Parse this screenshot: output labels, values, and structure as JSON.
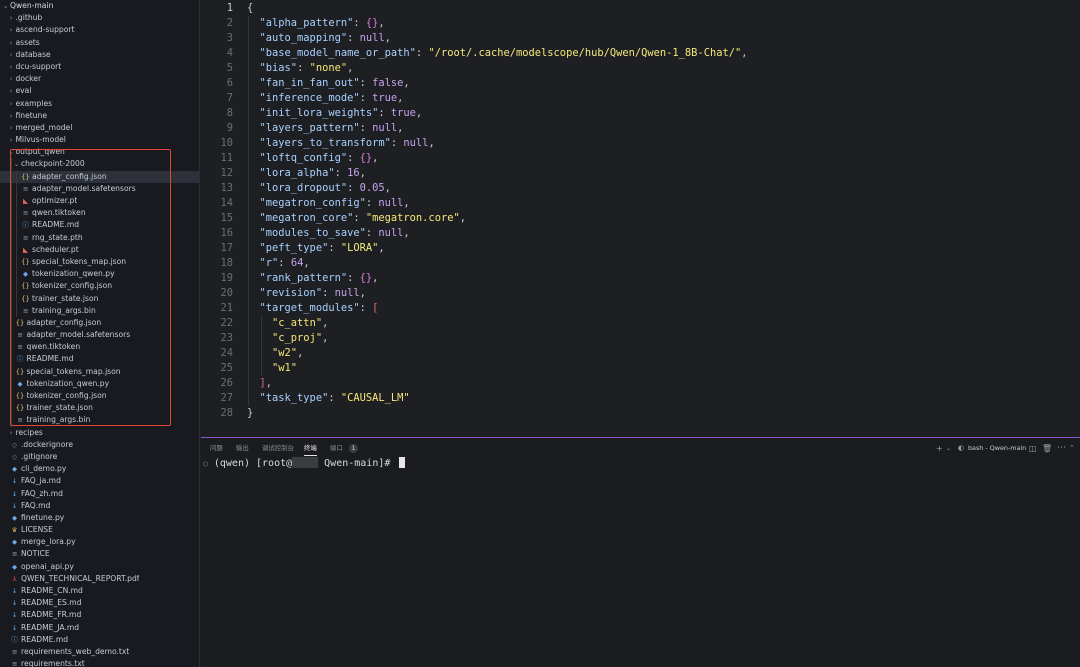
{
  "explorer": {
    "rows": [
      {
        "label": "Qwen-main",
        "depth": 0,
        "kind": "folder-open",
        "icon": "chevron-down-icon"
      },
      {
        "label": ".github",
        "depth": 1,
        "kind": "folder"
      },
      {
        "label": "ascend-support",
        "depth": 1,
        "kind": "folder"
      },
      {
        "label": "assets",
        "depth": 1,
        "kind": "folder"
      },
      {
        "label": "database",
        "depth": 1,
        "kind": "folder"
      },
      {
        "label": "dcu-support",
        "depth": 1,
        "kind": "folder"
      },
      {
        "label": "docker",
        "depth": 1,
        "kind": "folder"
      },
      {
        "label": "eval",
        "depth": 1,
        "kind": "folder"
      },
      {
        "label": "examples",
        "depth": 1,
        "kind": "folder"
      },
      {
        "label": "finetune",
        "depth": 1,
        "kind": "folder"
      },
      {
        "label": "merged_model",
        "depth": 1,
        "kind": "folder"
      },
      {
        "label": "Milvus-model",
        "depth": 1,
        "kind": "folder"
      },
      {
        "label": "output_qwen",
        "depth": 1,
        "kind": "folder-open"
      },
      {
        "label": "checkpoint-2000",
        "depth": 2,
        "kind": "folder-open"
      },
      {
        "label": "adapter_config.json",
        "depth": 3,
        "kind": "json",
        "selected": true
      },
      {
        "label": "adapter_model.safetensors",
        "depth": 3,
        "kind": "txt"
      },
      {
        "label": "optimizer.pt",
        "depth": 3,
        "kind": "pt"
      },
      {
        "label": "qwen.tiktoken",
        "depth": 3,
        "kind": "txt"
      },
      {
        "label": "README.md",
        "depth": 3,
        "kind": "info"
      },
      {
        "label": "rng_state.pth",
        "depth": 3,
        "kind": "txt"
      },
      {
        "label": "scheduler.pt",
        "depth": 3,
        "kind": "pt"
      },
      {
        "label": "special_tokens_map.json",
        "depth": 3,
        "kind": "json"
      },
      {
        "label": "tokenization_qwen.py",
        "depth": 3,
        "kind": "py"
      },
      {
        "label": "tokenizer_config.json",
        "depth": 3,
        "kind": "json"
      },
      {
        "label": "trainer_state.json",
        "depth": 3,
        "kind": "json"
      },
      {
        "label": "training_args.bin",
        "depth": 3,
        "kind": "txt"
      },
      {
        "label": "adapter_config.json",
        "depth": 2,
        "kind": "json"
      },
      {
        "label": "adapter_model.safetensors",
        "depth": 2,
        "kind": "txt"
      },
      {
        "label": "qwen.tiktoken",
        "depth": 2,
        "kind": "txt"
      },
      {
        "label": "README.md",
        "depth": 2,
        "kind": "info"
      },
      {
        "label": "special_tokens_map.json",
        "depth": 2,
        "kind": "json"
      },
      {
        "label": "tokenization_qwen.py",
        "depth": 2,
        "kind": "py"
      },
      {
        "label": "tokenizer_config.json",
        "depth": 2,
        "kind": "json"
      },
      {
        "label": "trainer_state.json",
        "depth": 2,
        "kind": "json"
      },
      {
        "label": "training_args.bin",
        "depth": 2,
        "kind": "txt"
      },
      {
        "label": "recipes",
        "depth": 1,
        "kind": "folder"
      },
      {
        "label": ".dockerignore",
        "depth": 1,
        "kind": "git"
      },
      {
        "label": ".gitignore",
        "depth": 1,
        "kind": "git"
      },
      {
        "label": "cli_demo.py",
        "depth": 1,
        "kind": "py"
      },
      {
        "label": "FAQ_ja.md",
        "depth": 1,
        "kind": "md"
      },
      {
        "label": "FAQ_zh.md",
        "depth": 1,
        "kind": "md"
      },
      {
        "label": "FAQ.md",
        "depth": 1,
        "kind": "md"
      },
      {
        "label": "finetune.py",
        "depth": 1,
        "kind": "py"
      },
      {
        "label": "LICENSE",
        "depth": 1,
        "kind": "lic"
      },
      {
        "label": "merge_lora.py",
        "depth": 1,
        "kind": "py"
      },
      {
        "label": "NOTICE",
        "depth": 1,
        "kind": "txt"
      },
      {
        "label": "openai_api.py",
        "depth": 1,
        "kind": "py"
      },
      {
        "label": "QWEN_TECHNICAL_REPORT.pdf",
        "depth": 1,
        "kind": "pdf"
      },
      {
        "label": "README_CN.md",
        "depth": 1,
        "kind": "md"
      },
      {
        "label": "README_ES.md",
        "depth": 1,
        "kind": "md"
      },
      {
        "label": "README_FR.md",
        "depth": 1,
        "kind": "md"
      },
      {
        "label": "README_JA.md",
        "depth": 1,
        "kind": "md"
      },
      {
        "label": "README.md",
        "depth": 1,
        "kind": "info"
      },
      {
        "label": "requirements_web_demo.txt",
        "depth": 1,
        "kind": "txt"
      },
      {
        "label": "requirements.txt",
        "depth": 1,
        "kind": "txt"
      }
    ]
  },
  "editor": {
    "active_line": 1,
    "lines": [
      [
        [
          "{",
          "p"
        ]
      ],
      [
        [
          "\"alpha_pattern\"",
          "k"
        ],
        [
          ": ",
          "p"
        ],
        [
          "{}",
          "br-m"
        ],
        [
          ",",
          "p"
        ]
      ],
      [
        [
          "\"auto_mapping\"",
          "k"
        ],
        [
          ": ",
          "p"
        ],
        [
          "null",
          "n"
        ],
        [
          ",",
          "p"
        ]
      ],
      [
        [
          "\"base_model_name_or_path\"",
          "k"
        ],
        [
          ": ",
          "p"
        ],
        [
          "\"/root/.cache/modelscope/hub/Qwen/Qwen-1_8B-Chat/\"",
          "s"
        ],
        [
          ",",
          "p"
        ]
      ],
      [
        [
          "\"bias\"",
          "k"
        ],
        [
          ": ",
          "p"
        ],
        [
          "\"none\"",
          "s"
        ],
        [
          ",",
          "p"
        ]
      ],
      [
        [
          "\"fan_in_fan_out\"",
          "k"
        ],
        [
          ": ",
          "p"
        ],
        [
          "false",
          "n"
        ],
        [
          ",",
          "p"
        ]
      ],
      [
        [
          "\"inference_mode\"",
          "k"
        ],
        [
          ": ",
          "p"
        ],
        [
          "true",
          "n"
        ],
        [
          ",",
          "p"
        ]
      ],
      [
        [
          "\"init_lora_weights\"",
          "k"
        ],
        [
          ": ",
          "p"
        ],
        [
          "true",
          "n"
        ],
        [
          ",",
          "p"
        ]
      ],
      [
        [
          "\"layers_pattern\"",
          "k"
        ],
        [
          ": ",
          "p"
        ],
        [
          "null",
          "n"
        ],
        [
          ",",
          "p"
        ]
      ],
      [
        [
          "\"layers_to_transform\"",
          "k"
        ],
        [
          ": ",
          "p"
        ],
        [
          "null",
          "n"
        ],
        [
          ",",
          "p"
        ]
      ],
      [
        [
          "\"loftq_config\"",
          "k"
        ],
        [
          ": ",
          "p"
        ],
        [
          "{}",
          "br-m"
        ],
        [
          ",",
          "p"
        ]
      ],
      [
        [
          "\"lora_alpha\"",
          "k"
        ],
        [
          ": ",
          "p"
        ],
        [
          "16",
          "n"
        ],
        [
          ",",
          "p"
        ]
      ],
      [
        [
          "\"lora_dropout\"",
          "k"
        ],
        [
          ": ",
          "p"
        ],
        [
          "0.05",
          "n"
        ],
        [
          ",",
          "p"
        ]
      ],
      [
        [
          "\"megatron_config\"",
          "k"
        ],
        [
          ": ",
          "p"
        ],
        [
          "null",
          "n"
        ],
        [
          ",",
          "p"
        ]
      ],
      [
        [
          "\"megatron_core\"",
          "k"
        ],
        [
          ": ",
          "p"
        ],
        [
          "\"megatron.core\"",
          "s"
        ],
        [
          ",",
          "p"
        ]
      ],
      [
        [
          "\"modules_to_save\"",
          "k"
        ],
        [
          ": ",
          "p"
        ],
        [
          "null",
          "n"
        ],
        [
          ",",
          "p"
        ]
      ],
      [
        [
          "\"peft_type\"",
          "k"
        ],
        [
          ": ",
          "p"
        ],
        [
          "\"LORA\"",
          "s"
        ],
        [
          ",",
          "p"
        ]
      ],
      [
        [
          "\"r\"",
          "k"
        ],
        [
          ": ",
          "p"
        ],
        [
          "64",
          "n"
        ],
        [
          ",",
          "p"
        ]
      ],
      [
        [
          "\"rank_pattern\"",
          "k"
        ],
        [
          ": ",
          "p"
        ],
        [
          "{}",
          "br-m"
        ],
        [
          ",",
          "p"
        ]
      ],
      [
        [
          "\"revision\"",
          "k"
        ],
        [
          ": ",
          "p"
        ],
        [
          "null",
          "n"
        ],
        [
          ",",
          "p"
        ]
      ],
      [
        [
          "\"target_modules\"",
          "k"
        ],
        [
          ": ",
          "p"
        ],
        [
          "[",
          "br-r"
        ]
      ],
      [
        [
          "\"c_attn\"",
          "s"
        ],
        [
          ",",
          "p"
        ]
      ],
      [
        [
          "\"c_proj\"",
          "s"
        ],
        [
          ",",
          "p"
        ]
      ],
      [
        [
          "\"w2\"",
          "s"
        ],
        [
          ",",
          "p"
        ]
      ],
      [
        [
          "\"w1\"",
          "s"
        ]
      ],
      [
        [
          "]",
          "br-r"
        ],
        [
          ",",
          "p"
        ]
      ],
      [
        [
          "\"task_type\"",
          "k"
        ],
        [
          ": ",
          "p"
        ],
        [
          "\"CAUSAL_LM\"",
          "s"
        ]
      ],
      [
        [
          "}",
          "p"
        ]
      ]
    ],
    "indents": [
      0,
      1,
      1,
      1,
      1,
      1,
      1,
      1,
      1,
      1,
      1,
      1,
      1,
      1,
      1,
      1,
      1,
      1,
      1,
      1,
      1,
      2,
      2,
      2,
      2,
      1,
      1,
      0
    ]
  },
  "panel": {
    "tabs": [
      {
        "label": "问题"
      },
      {
        "label": "输出"
      },
      {
        "label": "调试控制台"
      },
      {
        "label": "终端",
        "active": true
      },
      {
        "label": "端口"
      }
    ],
    "ports_badge": "1",
    "terminal_name": "bash - Qwen-main",
    "prompt_prefix": "(qwen) [root@",
    "prompt_suffix": " Qwen-main]# "
  }
}
